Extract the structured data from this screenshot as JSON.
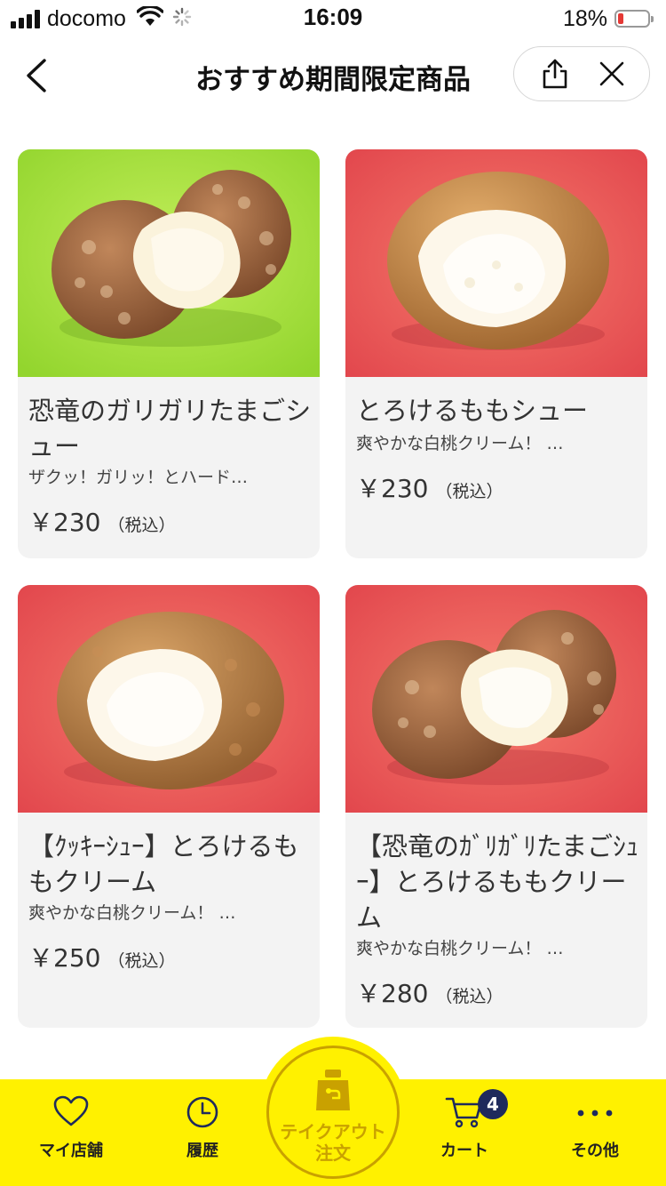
{
  "status_bar": {
    "carrier": "docomo",
    "time": "16:09",
    "battery_percent": "18%",
    "battery_level": 0.18
  },
  "nav": {
    "title": "おすすめ期間限定商品"
  },
  "products": [
    {
      "name": "恐竜のガリガリたまごシュー",
      "description": "ザクッ！ガリッ！とハード…",
      "price": "￥230",
      "tax_note": "（税込）",
      "background_color": "#a6e23c"
    },
    {
      "name": "とろけるももシュー",
      "description": "爽やかな白桃クリーム！ …",
      "price": "￥230",
      "tax_note": "（税込）",
      "background_color": "#ee5f5f"
    },
    {
      "name": "【ｸｯｷｰｼｭｰ】とろけるももクリーム",
      "description": "爽やかな白桃クリーム！ …",
      "price": "￥250",
      "tax_note": "（税込）",
      "background_color": "#ee5f5f"
    },
    {
      "name": "【恐竜のｶﾞﾘｶﾞﾘたまごｼｭｰ】とろけるももクリーム",
      "description": "爽やかな白桃クリーム！ …",
      "price": "￥280",
      "tax_note": "（税込）",
      "background_color": "#ee5f5f"
    }
  ],
  "tab_bar": {
    "my_store": "マイ店舗",
    "history": "履歴",
    "takeout_line1": "テイクアウト",
    "takeout_line2": "注文",
    "cart": "カート",
    "cart_badge": "4",
    "other": "その他"
  },
  "colors": {
    "accent_yellow": "#fff100",
    "accent_gold": "#c9a100",
    "badge_navy": "#1f2a5c",
    "card_bg": "#f3f3f3"
  }
}
